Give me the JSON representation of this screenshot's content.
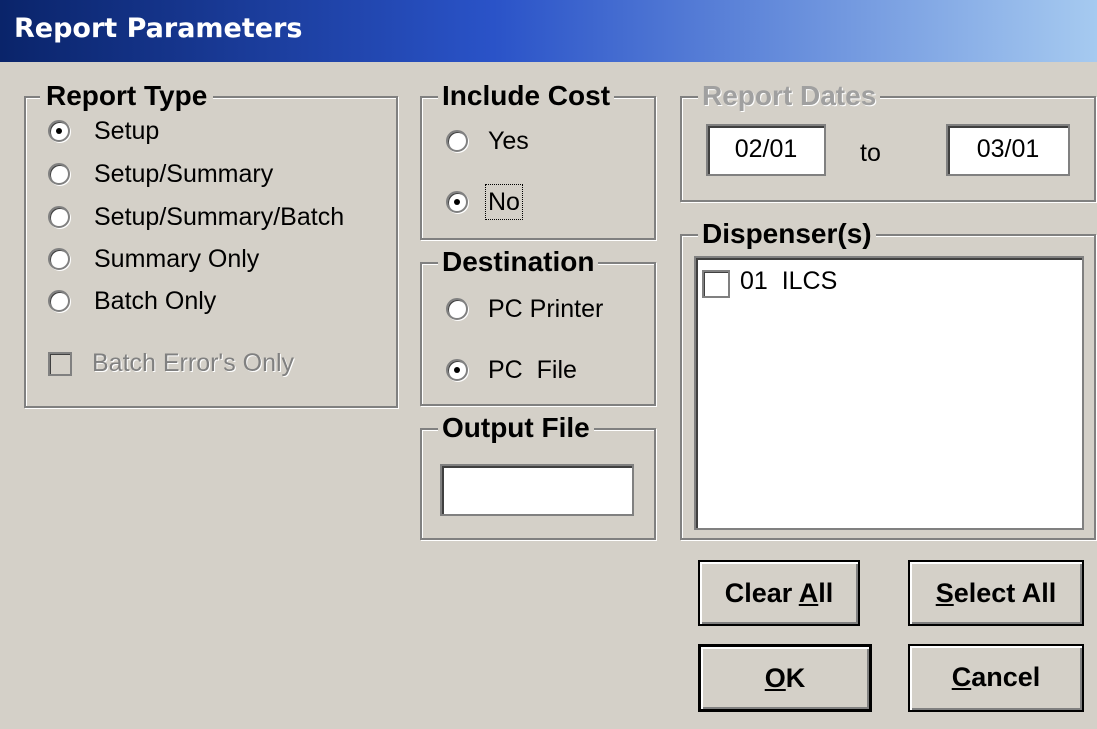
{
  "window": {
    "title": "Report Parameters"
  },
  "report_type": {
    "legend": "Report Type",
    "options": [
      {
        "label": "Setup",
        "selected": true
      },
      {
        "label": "Setup/Summary",
        "selected": false
      },
      {
        "label": "Setup/Summary/Batch",
        "selected": false
      },
      {
        "label": "Summary Only",
        "selected": false
      },
      {
        "label": "Batch Only",
        "selected": false
      }
    ],
    "batch_errors_label": "Batch Error's Only"
  },
  "include_cost": {
    "legend": "Include Cost",
    "options": [
      {
        "label": "Yes",
        "selected": false
      },
      {
        "label": "No",
        "selected": true
      }
    ]
  },
  "destination": {
    "legend": "Destination",
    "options": [
      {
        "label": "PC Printer",
        "selected": false
      },
      {
        "label": "PC  File",
        "selected": true
      }
    ]
  },
  "output_file": {
    "legend": "Output File",
    "value": ""
  },
  "report_dates": {
    "legend": "Report Dates",
    "from": "02/01",
    "separator": "to",
    "to": "03/01"
  },
  "dispensers": {
    "legend": "Dispenser(s)",
    "items": [
      {
        "label": "01  ILCS",
        "checked": false
      }
    ]
  },
  "buttons": {
    "clear_all": {
      "pre": "Clear ",
      "key": "A",
      "post": "ll"
    },
    "select_all": {
      "pre": "",
      "key": "S",
      "post": "elect All"
    },
    "ok": {
      "pre": "",
      "key": "O",
      "post": "K"
    },
    "cancel": {
      "pre": "",
      "key": "C",
      "post": "ancel"
    }
  }
}
